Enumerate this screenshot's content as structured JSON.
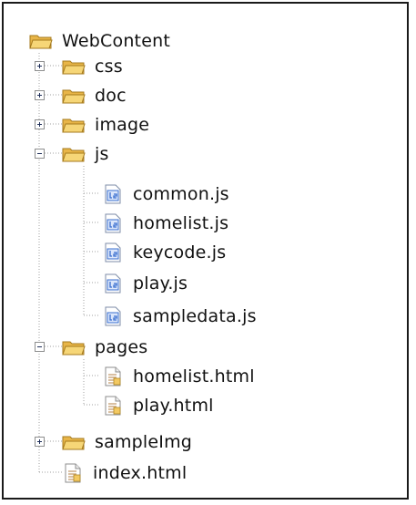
{
  "tree": {
    "root": {
      "label": "WebContent",
      "icon": "folder-open-icon"
    },
    "items": [
      {
        "label": "css",
        "type": "folder",
        "expanded": false
      },
      {
        "label": "doc",
        "type": "folder",
        "expanded": false
      },
      {
        "label": "image",
        "type": "folder",
        "expanded": false
      },
      {
        "label": "js",
        "type": "folder",
        "expanded": true,
        "children": [
          "common.js",
          "homelist.js",
          "keycode.js",
          "play.js",
          "sampledata.js"
        ]
      },
      {
        "label": "pages",
        "type": "folder",
        "expanded": true,
        "children": [
          "homelist.html",
          "play.html"
        ]
      },
      {
        "label": "sampleImg",
        "type": "folder",
        "expanded": false
      },
      {
        "label": "index.html",
        "type": "html-file"
      }
    ]
  },
  "colors": {
    "folder": "#f3c962",
    "folder_dark": "#c79a2a",
    "js_badge": "#3a6fcf",
    "html_lines": "#c49a6c",
    "tree_line": "#a0a0a0"
  }
}
